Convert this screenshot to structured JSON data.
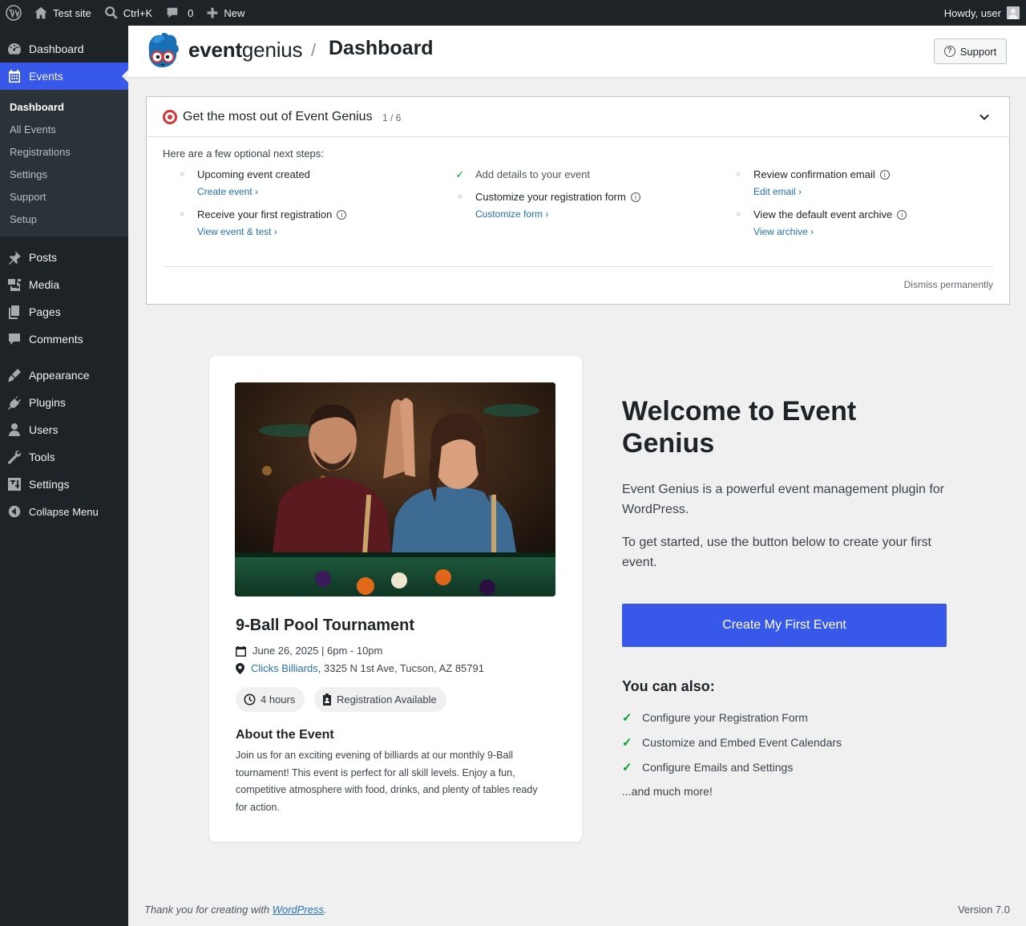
{
  "adminbar": {
    "site_name": "Test site",
    "search_shortcut": "Ctrl+K",
    "comments_count": "0",
    "new_label": "New",
    "howdy": "Howdy, user"
  },
  "sidebar": {
    "items_top": [
      {
        "label": "Dashboard",
        "icon": "dashboard-icon"
      },
      {
        "label": "Events",
        "icon": "calendar-icon",
        "active": true
      }
    ],
    "events_submenu": [
      "Dashboard",
      "All Events",
      "Registrations",
      "Settings",
      "Support",
      "Setup"
    ],
    "items_mid": [
      {
        "label": "Posts",
        "icon": "pin-icon"
      },
      {
        "label": "Media",
        "icon": "media-icon"
      },
      {
        "label": "Pages",
        "icon": "pages-icon"
      },
      {
        "label": "Comments",
        "icon": "comment-icon"
      }
    ],
    "items_bottom": [
      {
        "label": "Appearance",
        "icon": "brush-icon"
      },
      {
        "label": "Plugins",
        "icon": "plug-icon"
      },
      {
        "label": "Users",
        "icon": "user-icon"
      },
      {
        "label": "Tools",
        "icon": "wrench-icon"
      },
      {
        "label": "Settings",
        "icon": "settings-icon"
      }
    ],
    "collapse_label": "Collapse Menu"
  },
  "header": {
    "brand_bold": "event",
    "brand_light": "genius",
    "separator": "/",
    "title": "Dashboard",
    "support_label": "Support"
  },
  "onboarding": {
    "title": "Get the most out of Event Genius",
    "progress": "1 / 6",
    "intro": "Here are a few optional next steps:",
    "steps": [
      {
        "label": "Upcoming event created",
        "link": "Create event ›",
        "done": false,
        "info": false
      },
      {
        "label": "Receive your first registration",
        "link": "View event & test ›",
        "done": false,
        "info": true
      },
      {
        "label": "Add details to your event",
        "link": "",
        "done": true,
        "info": false
      },
      {
        "label": "Customize your registration form",
        "link": "Customize form ›",
        "done": false,
        "info": true
      },
      {
        "label": "Review confirmation email",
        "link": "Edit email ›",
        "done": false,
        "info": true
      },
      {
        "label": "View the default event archive",
        "link": "View archive ›",
        "done": false,
        "info": true
      }
    ],
    "dismiss": "Dismiss permanently"
  },
  "event_preview": {
    "title": "9-Ball Pool Tournament",
    "date": "June 26, 2025 | 6pm - 10pm",
    "venue": "Clicks Billiards",
    "address": ", 3325 N 1st Ave, Tucson, AZ 85791",
    "duration": "4 hours",
    "registration": "Registration Available",
    "about_heading": "About the Event",
    "about_text": "Join us for an exciting evening of billiards at our monthly 9-Ball tournament! This event is perfect for all skill levels. Enjoy a fun, competitive atmosphere with food, drinks, and plenty of tables ready for action."
  },
  "welcome": {
    "heading": "Welcome to Event Genius",
    "p1": "Event Genius is a powerful event management plugin for WordPress.",
    "p2": "To get started, use the button below to create your first event.",
    "cta": "Create My First Event",
    "also_heading": "You can also:",
    "also_items": [
      "Configure your Registration Form",
      "Customize and Embed Event Calendars",
      "Configure Emails and Settings"
    ],
    "more": "...and much more!"
  },
  "footer": {
    "thanks_prefix": "Thank you for creating with ",
    "wp_link": "WordPress",
    "thanks_suffix": ".",
    "version": "Version 7.0"
  },
  "colors": {
    "accent": "#3858e9",
    "admin_dark": "#1d2327",
    "link": "#2271b1",
    "success": "#00a32a"
  }
}
